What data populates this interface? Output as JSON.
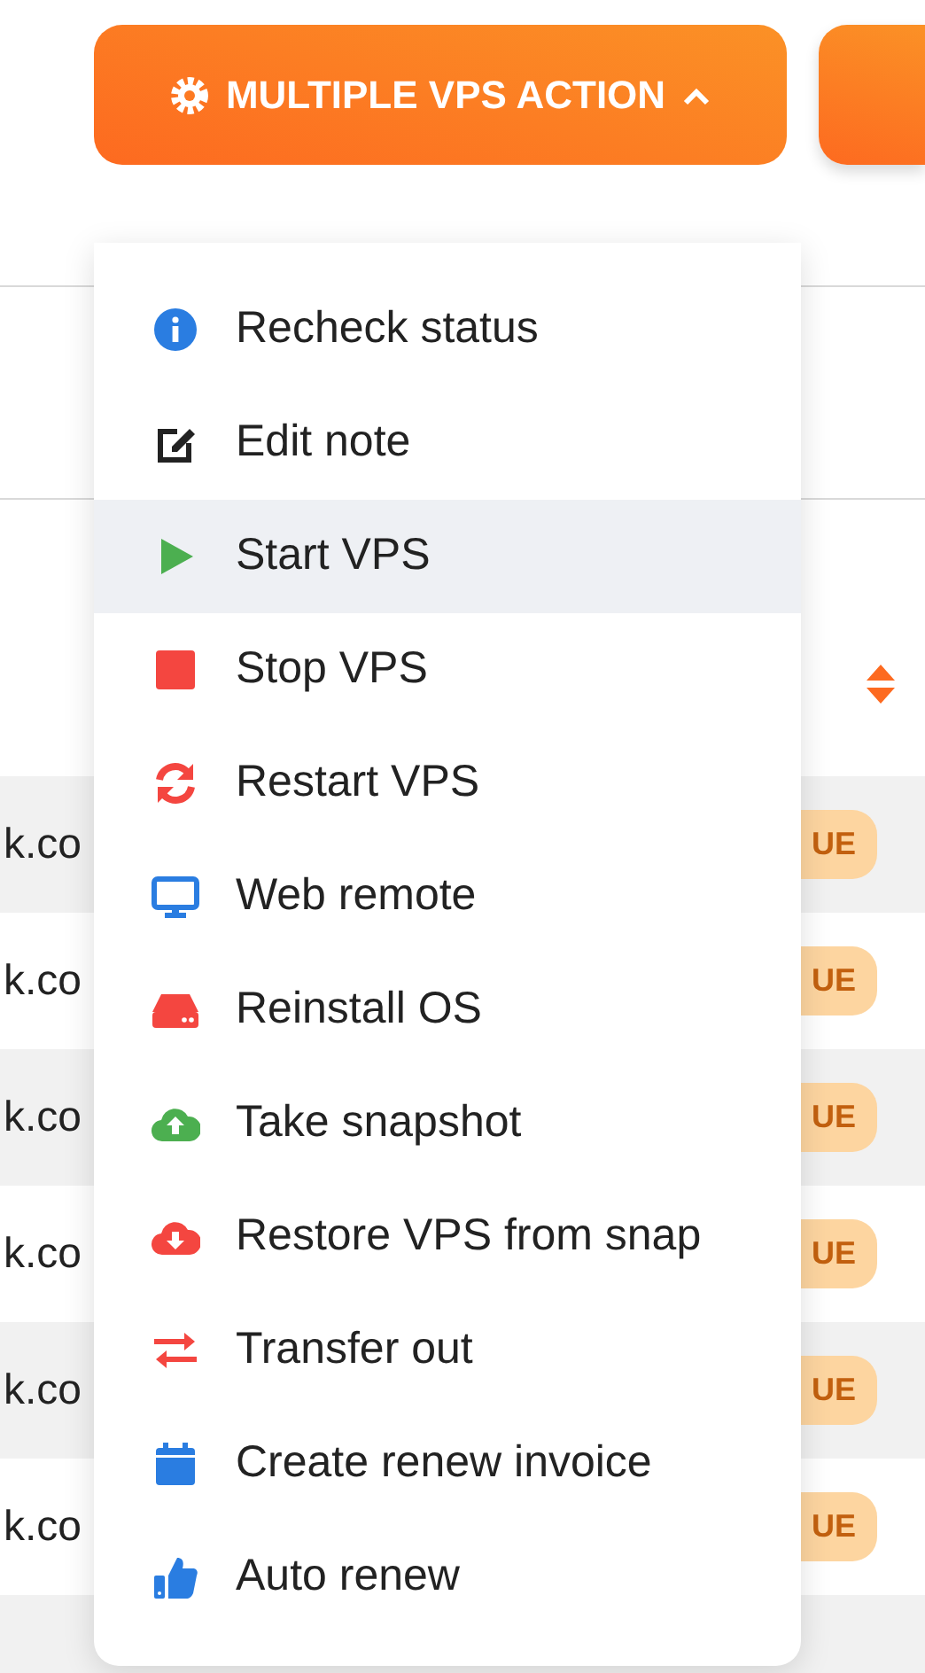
{
  "toolbar": {
    "action_button": {
      "label": "MULTIPLE VPS ACTION",
      "expanded": true
    }
  },
  "table": {
    "rows": [
      {
        "column_1": "k.co",
        "status": "UE"
      },
      {
        "column_1": "k.co",
        "status": "UE"
      },
      {
        "column_1": "k.co",
        "status": "UE"
      },
      {
        "column_1": "k.co",
        "status": "UE"
      },
      {
        "column_1": "k.co",
        "status": "UE"
      },
      {
        "column_1": "k.co",
        "status": "UE"
      }
    ]
  },
  "menu": {
    "items": [
      {
        "label": "Recheck status",
        "kind": "info",
        "selected": false
      },
      {
        "label": "Edit note",
        "kind": "edit",
        "selected": false
      },
      {
        "label": "Start VPS",
        "kind": "play",
        "selected": true
      },
      {
        "label": "Stop VPS",
        "kind": "stop",
        "selected": false
      },
      {
        "label": "Restart VPS",
        "kind": "restart",
        "selected": false
      },
      {
        "label": "Web remote",
        "kind": "monitor",
        "selected": false
      },
      {
        "label": "Reinstall OS",
        "kind": "drive",
        "selected": false
      },
      {
        "label": "Take snapshot",
        "kind": "upload",
        "selected": false
      },
      {
        "label": "Restore VPS from snap",
        "kind": "download",
        "selected": false
      },
      {
        "label": "Transfer out",
        "kind": "transfer",
        "selected": false
      },
      {
        "label": "Create renew invoice",
        "kind": "invoice",
        "selected": false
      },
      {
        "label": "Auto renew",
        "kind": "renew",
        "selected": false
      }
    ]
  }
}
